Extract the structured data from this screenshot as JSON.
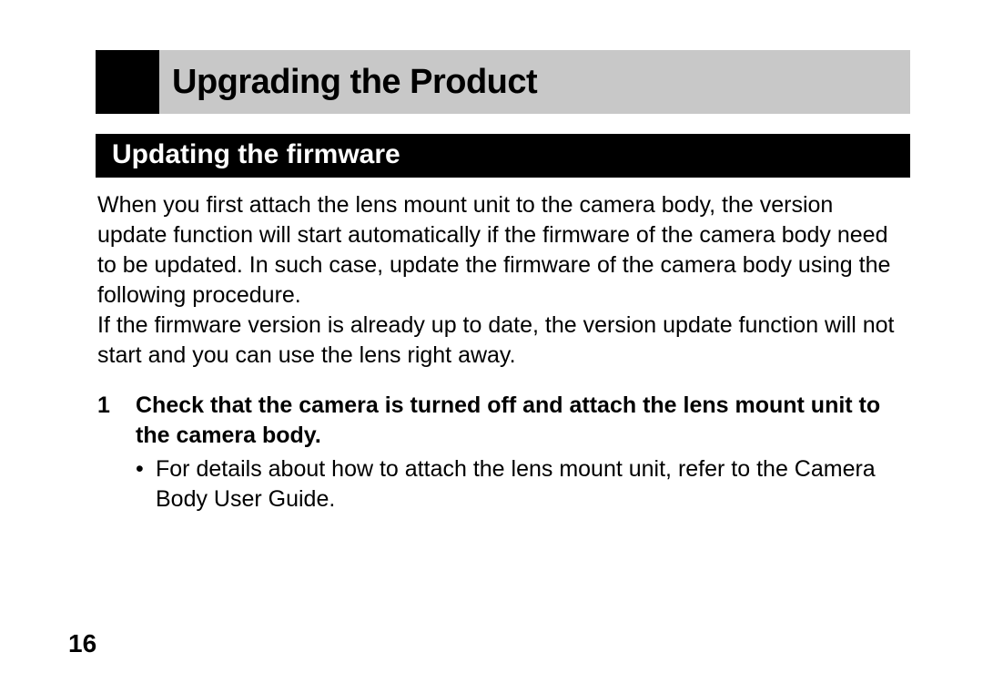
{
  "section": {
    "title": "Upgrading the Product"
  },
  "subsection": {
    "title": "Updating the firmware"
  },
  "paragraphs": {
    "p1": "When you first attach the lens mount unit to the camera body, the version update function will start automatically if the firmware of the camera body need to be updated. In such case, update the firmware of the camera body using the following procedure.",
    "p2": "If the firmware version is already up to date, the version update function will not start and you can use the lens right away."
  },
  "step": {
    "number": "1",
    "text": "Check that the camera is turned off and attach the lens mount unit to the camera body.",
    "bullet": "For details about how to attach the lens mount unit, refer to the Camera Body User Guide."
  },
  "page_number": "16"
}
